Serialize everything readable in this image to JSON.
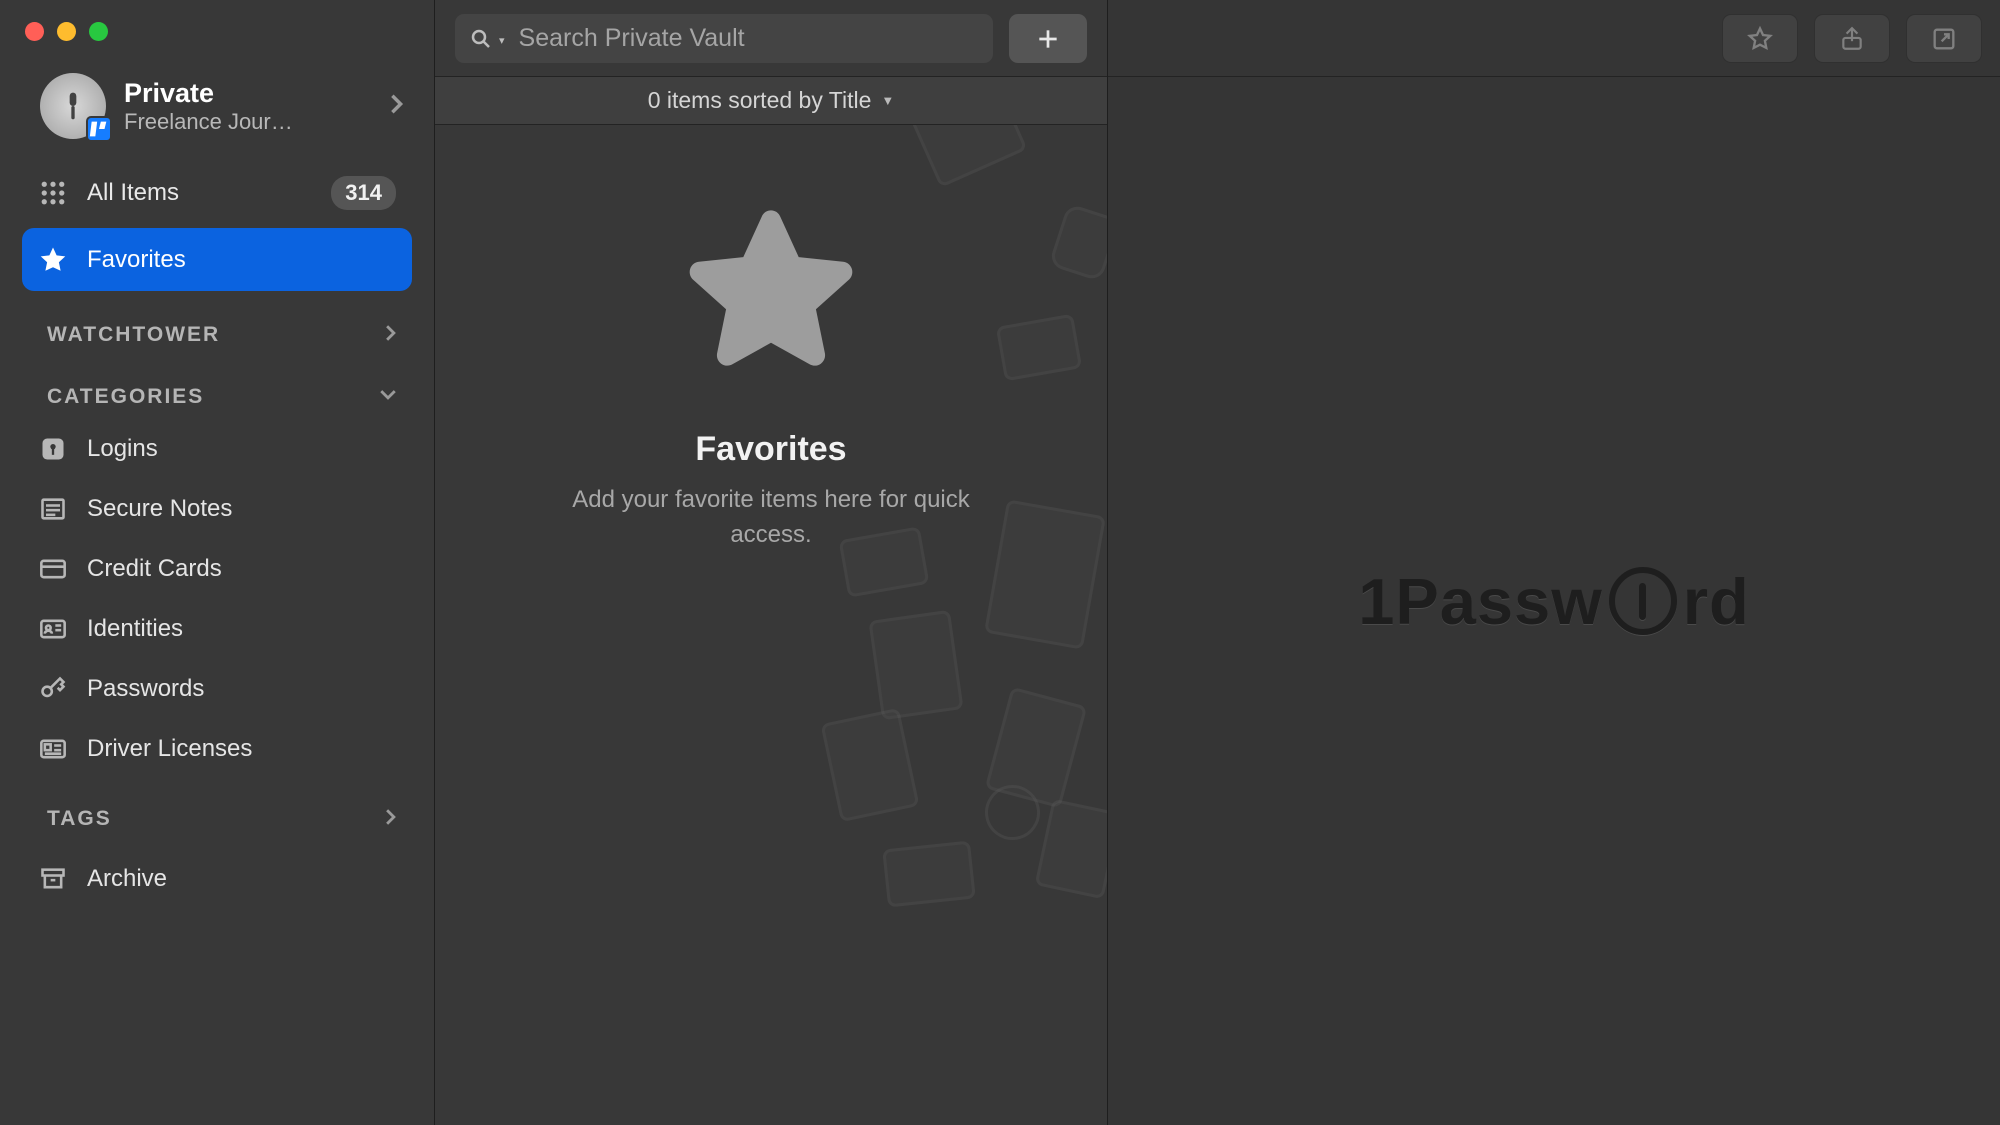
{
  "vault": {
    "name": "Private",
    "subtitle": "Freelance Jour…"
  },
  "sidebar": {
    "allItems": {
      "label": "All Items",
      "count": "314"
    },
    "favorites": {
      "label": "Favorites"
    },
    "sections": {
      "watchtower": "WATCHTOWER",
      "categories": "CATEGORIES",
      "tags": "TAGS"
    },
    "categories": [
      {
        "label": "Logins"
      },
      {
        "label": "Secure Notes"
      },
      {
        "label": "Credit Cards"
      },
      {
        "label": "Identities"
      },
      {
        "label": "Passwords"
      },
      {
        "label": "Driver Licenses"
      }
    ],
    "tags": [
      {
        "label": "Archive"
      }
    ]
  },
  "search": {
    "placeholder": "Search Private Vault"
  },
  "listSummary": "0 items sorted by Title",
  "emptyState": {
    "title": "Favorites",
    "subtitle": "Add your favorite items here for quick access."
  },
  "brand": {
    "part1": "1Passw",
    "part2": "rd"
  }
}
